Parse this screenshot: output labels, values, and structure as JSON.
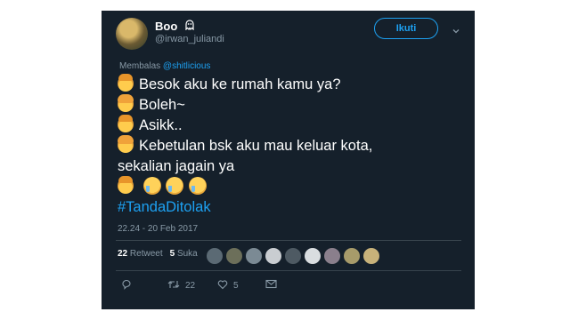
{
  "tweet": {
    "name": "Boo",
    "handle": "@irwan_juliandi",
    "follow_label": "Ikuti",
    "reply_to_prefix": "Membalas",
    "reply_to_user": "@shitlicious",
    "lines": [
      "Besok aku ke rumah kamu ya?",
      "Boleh~",
      "Asikk..",
      "Kebetulan bsk aku mau keluar kota,",
      "sekalian jagain ya"
    ],
    "hashtag": "#TandaDitolak",
    "timestamp": "22.24 - 20 Feb 2017",
    "retweet_count": "22",
    "retweet_label": "Retweet",
    "like_count": "5",
    "like_label": "Suka",
    "action_retweet_count": "22",
    "action_like_count": "5"
  },
  "colors": {
    "background": "#15202b",
    "accent": "#1da1f2",
    "muted": "#8899a6"
  },
  "icons": [
    "ghost-icon",
    "chevron-down-icon",
    "reply-icon",
    "retweet-icon",
    "like-icon",
    "dm-icon"
  ]
}
